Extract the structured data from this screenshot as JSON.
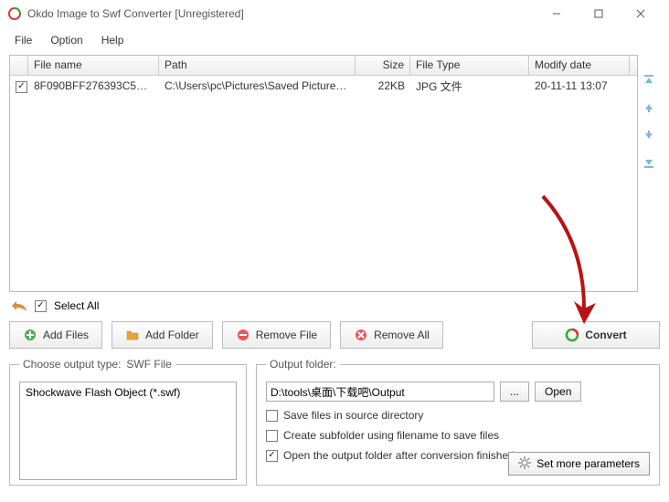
{
  "window": {
    "title": "Okdo Image to Swf Converter [Unregistered]"
  },
  "menu": {
    "file": "File",
    "option": "Option",
    "help": "Help"
  },
  "columns": {
    "filename": "File name",
    "path": "Path",
    "size": "Size",
    "filetype": "File Type",
    "modify": "Modify date"
  },
  "rows": [
    {
      "checked": true,
      "filename": "8F090BFF276393C5A901...",
      "path": "C:\\Users\\pc\\Pictures\\Saved Pictures\\...",
      "size": "22KB",
      "filetype": "JPG 文件",
      "modify": "20-11-11 13:07"
    }
  ],
  "selectAll": {
    "label": "Select All",
    "checked": true
  },
  "buttons": {
    "addFiles": "Add Files",
    "addFolder": "Add Folder",
    "removeFile": "Remove File",
    "removeAll": "Remove All",
    "convert": "Convert"
  },
  "outputType": {
    "legend_prefix": "Choose output type:",
    "legend_value": "SWF File",
    "listItem": "Shockwave Flash Object (*.swf)"
  },
  "outputFolder": {
    "legend": "Output folder:",
    "path": "D:\\tools\\桌面\\下载吧\\Output",
    "browse": "...",
    "open": "Open"
  },
  "options": {
    "saveInSource": {
      "label": "Save files in source directory",
      "checked": false
    },
    "createSubfolder": {
      "label": "Create subfolder using filename to save files",
      "checked": false
    },
    "openAfter": {
      "label": "Open the output folder after conversion finished",
      "checked": true
    }
  },
  "setMore": "Set more parameters"
}
